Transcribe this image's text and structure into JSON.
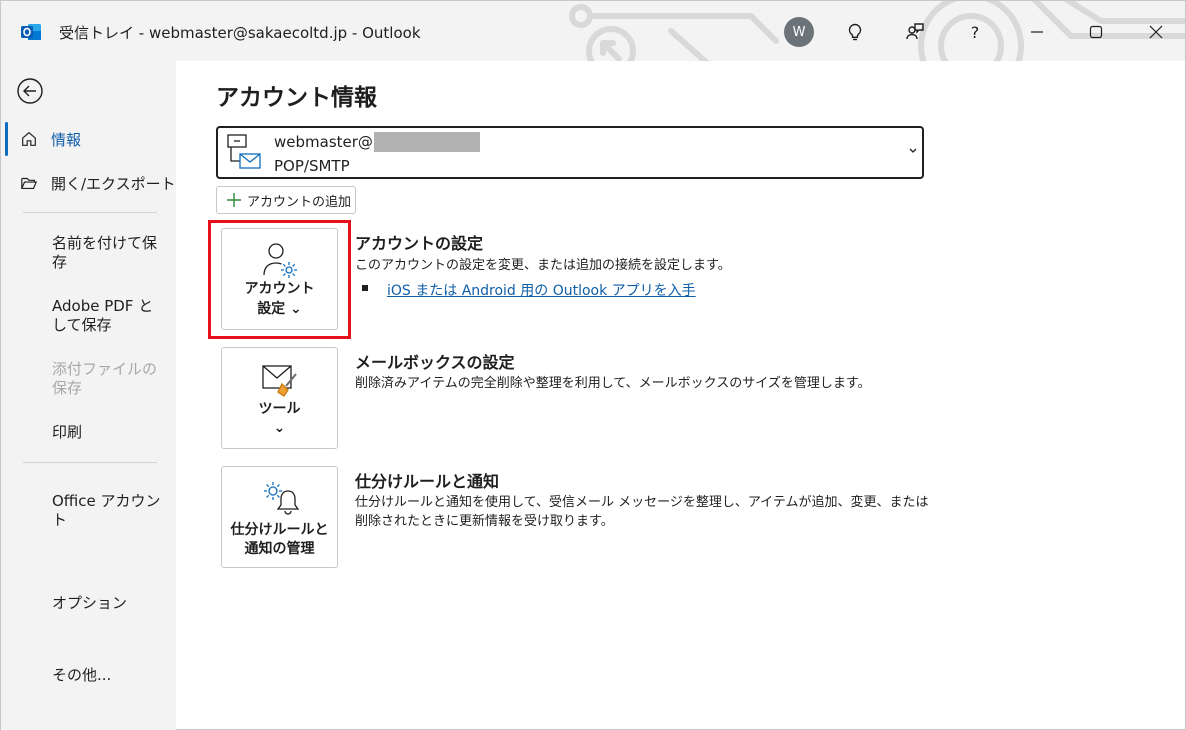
{
  "window": {
    "title": "受信トレイ - webmaster@sakaecoltd.jp  -  Outlook",
    "avatar_initial": "W",
    "help_label": "?"
  },
  "nav": {
    "items": [
      {
        "label": "情報"
      },
      {
        "label": "開く/エクスポート"
      },
      {
        "label": "名前を付けて保存"
      },
      {
        "label": "Adobe PDF として保存"
      },
      {
        "label": "添付ファイルの保存"
      },
      {
        "label": "印刷"
      },
      {
        "label": "Office アカウント"
      },
      {
        "label": "オプション"
      },
      {
        "label": "その他..."
      }
    ]
  },
  "main": {
    "page_title": "アカウント情報",
    "account": {
      "email_prefix": "webmaster@",
      "type": "POP/SMTP"
    },
    "add_account_label": "アカウントの追加",
    "sections": [
      {
        "tile_label_1": "アカウント",
        "tile_label_2": "設定 ⌄",
        "title": "アカウントの設定",
        "description": "このアカウントの設定を変更、または追加の接続を設定します。",
        "link": "iOS または Android 用の Outlook アプリを入手"
      },
      {
        "tile_label_1": "ツール",
        "tile_label_2": "⌄",
        "title": "メールボックスの設定",
        "description": "削除済みアイテムの完全削除や整理を利用して、メールボックスのサイズを管理します。"
      },
      {
        "tile_label_1": "仕分けルールと",
        "tile_label_2": "通知の管理",
        "title": "仕分けルールと通知",
        "description_1": "仕分けルールと通知を使用して、受信メール メッセージを整理し、アイテムが追加、変更、または",
        "description_2": "削除されたときに更新情報を受け取ります。"
      }
    ]
  },
  "colors": {
    "accent": "#0f6cbd",
    "highlight": "#e8101a",
    "link": "#0f5ea8"
  }
}
